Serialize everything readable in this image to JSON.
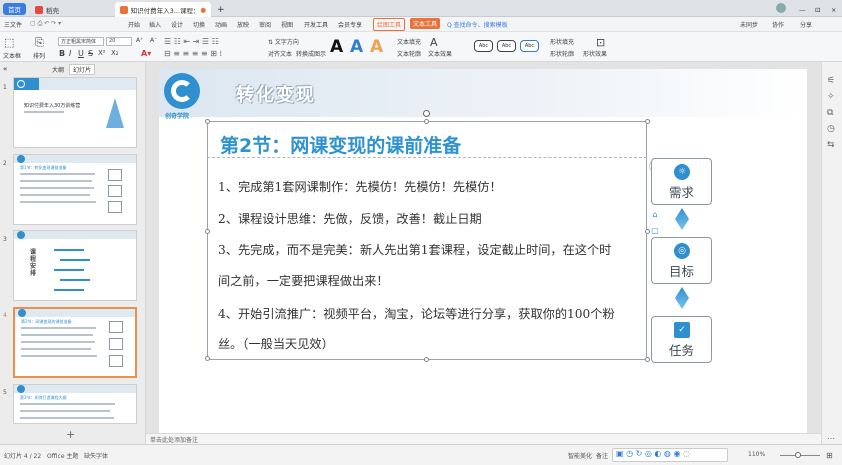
{
  "titlebar": {
    "home_tab": "首页",
    "template_tab": "稻壳",
    "doc_tab": "知识付费年入3...课程：转化变现.pptx",
    "new_tab": "+",
    "window_min": "—",
    "window_max": "⊡",
    "window_close": "×"
  },
  "menubar": {
    "file_menu": "三文件",
    "items": [
      "开始",
      "插入",
      "设计",
      "切换",
      "动画",
      "放映",
      "审阅",
      "视图",
      "开发工具",
      "会员专享"
    ],
    "drawing_tool": "绘图工具",
    "text_tool": "文本工具",
    "search": "Q 查找命令、搜索模板",
    "right_items": [
      "未同步",
      "协作",
      "分享"
    ]
  },
  "ribbon": {
    "new_slide": "新建幻灯片",
    "layout": "版式",
    "font_name": "方正粗黑宋简体",
    "font_size": "20",
    "font_grow": "A⁺",
    "font_shrink": "A⁻",
    "bold": "B",
    "italic": "I",
    "underline": "U",
    "strike": "S",
    "sup": "X²",
    "sub": "X₂",
    "text_box": "文本框",
    "arrange": "排列",
    "text_fill": "文本填充",
    "text_outline": "文本轮廓",
    "text_effect": "文本效果",
    "shape_fill": "形状填充",
    "shape_outline": "形状轮廓",
    "shape_effect": "形状效果",
    "style_sample": "Abc",
    "align_text": "对齐文本",
    "convert_smartart": "转换成图示"
  },
  "leftpanel": {
    "tab_outline": "大纲",
    "tab_slides": "幻灯片",
    "collapse": "«",
    "thumbs": [
      {
        "num": "1",
        "title": "知识付费年入30万训练营"
      },
      {
        "num": "2",
        "title": "第1节：转化变现课前准备"
      },
      {
        "num": "3",
        "title": "课程安排"
      },
      {
        "num": "4",
        "title": "第2节：网课变现的课前准备"
      },
      {
        "num": "5",
        "title": "第3节：如何打造课程大纲"
      }
    ],
    "add_slide": "+"
  },
  "slide": {
    "header_title": "转化变现",
    "logo_caption": "创奇学院",
    "lesson_title": "第2节：网课变现的课前准备",
    "lines": [
      "1、完成第1套网课制作：先模仿！先模仿！先模仿！",
      "2、课程设计思维：先做，反馈，改善！截止日期",
      "3、先完成，而不是完美：新人先出第1套课程，设定截止时间，在这个时",
      "间之前，一定要把课程做出来！",
      "4、开始引流推广：视频平台，淘宝，论坛等进行分享，获取你的100个粉",
      "丝。（一般当天见效）"
    ],
    "side_boxes": [
      {
        "label": "需求",
        "icon": "lightbulb-icon"
      },
      {
        "label": "目标",
        "icon": "target-icon"
      },
      {
        "label": "任务",
        "icon": "clipboard-icon"
      }
    ],
    "accent": "#2f93cf"
  },
  "notes": {
    "placeholder": "单击此处添加备注"
  },
  "statusbar": {
    "slide_pos": "幻灯片 4 / 22",
    "theme": "Office 主题",
    "missing_font": "缺失字体",
    "beautify": "智能美化",
    "notes_btn": "备注",
    "zoom": "110%"
  }
}
